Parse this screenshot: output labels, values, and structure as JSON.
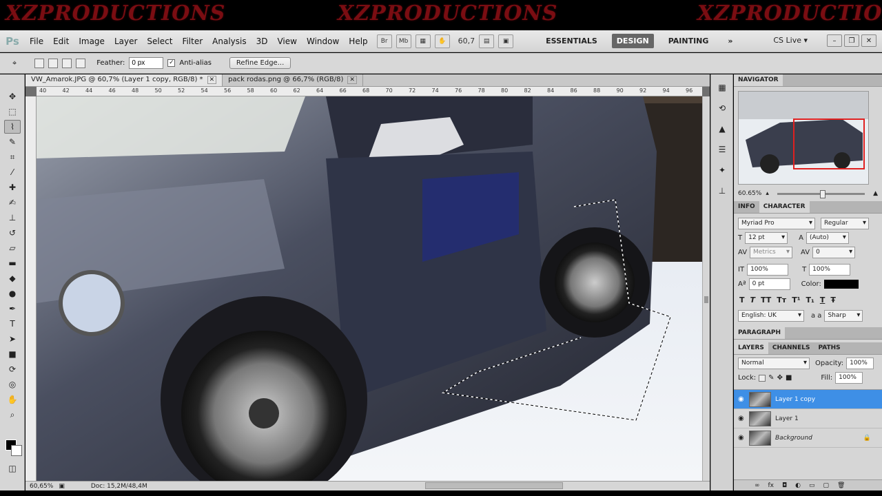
{
  "watermark": [
    "XZPRODUCTIONS",
    "XZPRODUCTIONS",
    "XZPRODUCTIONS"
  ],
  "app": {
    "logo": "Ps",
    "menus": [
      "File",
      "Edit",
      "Image",
      "Layer",
      "Select",
      "Filter",
      "Analysis",
      "3D",
      "View",
      "Window",
      "Help"
    ],
    "bridge": "Br",
    "minibridge": "Mb",
    "zoom": "60,7",
    "workspaces": [
      "ESSENTIALS",
      "DESIGN",
      "PAINTING"
    ],
    "more": "»",
    "cslive": "CS Live ▾"
  },
  "options": {
    "feather_label": "Feather:",
    "feather_value": "0 px",
    "antialias_label": "Anti-alias",
    "antialias_checked": "✓",
    "refine_label": "Refine Edge..."
  },
  "tabs": [
    {
      "label": "VW_Amarok.JPG @ 60,7% (Layer 1 copy, RGB/8) *",
      "close": "✕"
    },
    {
      "label": "pack rodas.png @ 66,7% (RGB/8)",
      "close": "✕"
    }
  ],
  "ruler": [
    "40",
    "42",
    "44",
    "46",
    "48",
    "50",
    "52",
    "54",
    "56",
    "58",
    "60",
    "62",
    "64",
    "66",
    "68",
    "70",
    "72",
    "74",
    "76",
    "78",
    "80",
    "82",
    "84",
    "86",
    "88",
    "90",
    "92",
    "94",
    "96"
  ],
  "status": {
    "zoom": "60,65%",
    "doc": "Doc: 15,2M/48,4M"
  },
  "navigator": {
    "title": "NAVIGATOR",
    "zoom": "60.65%"
  },
  "character": {
    "tab_info": "INFO",
    "tab_char": "CHARACTER",
    "font": "Myriad Pro",
    "style": "Regular",
    "size": "12 pt",
    "leading": "(Auto)",
    "kerning": "Metrics",
    "tracking": "0",
    "vscale": "100%",
    "hscale": "100%",
    "baseline": "0 pt",
    "color_label": "Color:",
    "language": "English: UK",
    "aa_icon": "a a",
    "aa": "Sharp",
    "type_buttons": [
      "T",
      "T",
      "TT",
      "Tт",
      "T¹",
      "T₁",
      "T",
      "Ŧ"
    ]
  },
  "paragraph": {
    "title": "PARAGRAPH"
  },
  "layers": {
    "tabs": [
      "LAYERS",
      "CHANNELS",
      "PATHS"
    ],
    "blend": "Normal",
    "opacity_label": "Opacity:",
    "opacity": "100%",
    "lock_label": "Lock:",
    "fill_label": "Fill:",
    "fill": "100%",
    "items": [
      "Layer 1 copy",
      "Layer 1",
      "Background"
    ],
    "lock_icon": "🔒"
  },
  "icons": {
    "close": "✕",
    "lock": "🔒",
    "eye": "👁"
  }
}
